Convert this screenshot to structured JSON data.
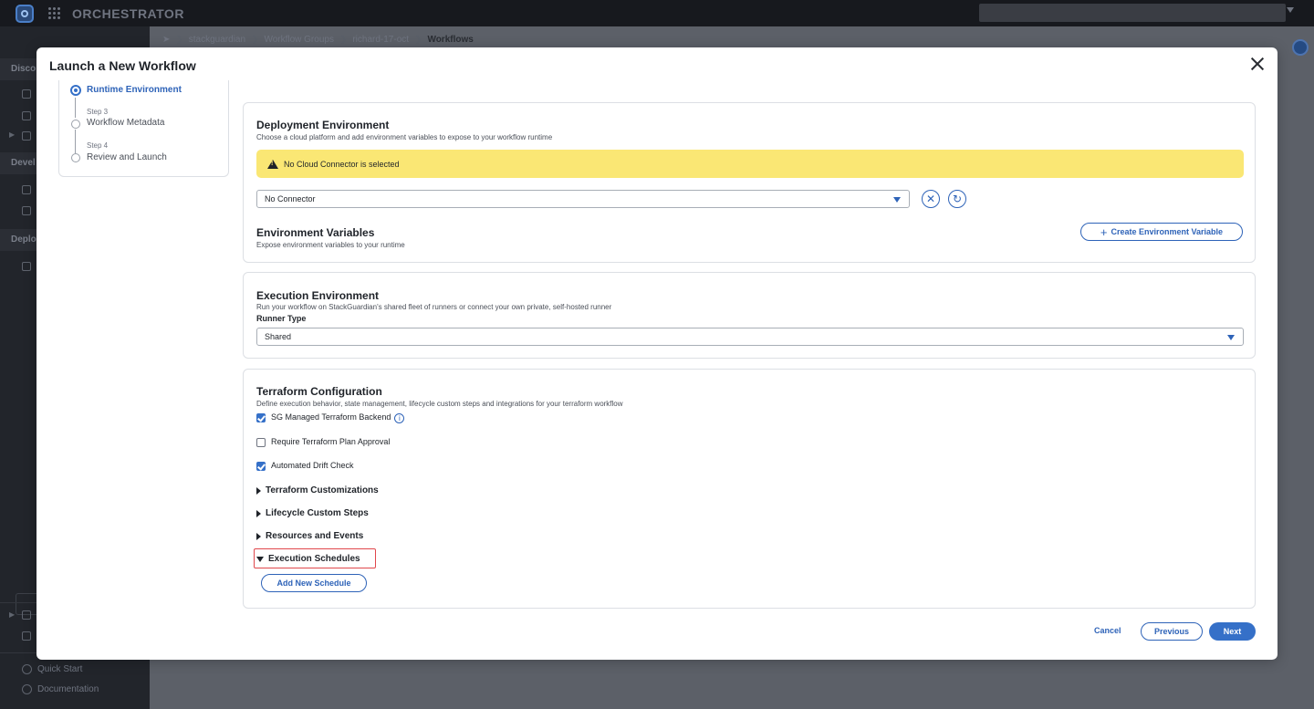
{
  "app": {
    "title": "ORCHESTRATOR"
  },
  "sidebar": {
    "sections": [
      "Disco",
      "Devel",
      "Deplo"
    ],
    "links": [
      "Quick Start",
      "Documentation"
    ]
  },
  "breadcrumb": [
    "stackguardian",
    "Workflow Groups",
    "richard-17-oct",
    "Workflows"
  ],
  "modal": {
    "title": "Launch a New Workflow",
    "stepper": {
      "steps": [
        {
          "number": "",
          "label": "Runtime Environment",
          "active": true
        },
        {
          "number": "Step 3",
          "label": "Workflow Metadata"
        },
        {
          "number": "Step 4",
          "label": "Review and Launch"
        }
      ]
    },
    "deployment": {
      "title": "Deployment Environment",
      "subtitle": "Choose a cloud platform and add environment variables to expose to your workflow runtime",
      "warning": "No Cloud Connector is selected",
      "connector_value": "No Connector",
      "env_title": "Environment Variables",
      "env_subtitle": "Expose environment variables to your runtime",
      "create_env_label": "Create Environment Variable"
    },
    "execution": {
      "title": "Execution Environment",
      "subtitle": "Run your workflow on StackGuardian's shared fleet of runners or connect your own private, self-hosted runner",
      "runner_type_label": "Runner Type",
      "runner_type_value": "Shared"
    },
    "terraform": {
      "title": "Terraform Configuration",
      "subtitle": "Define execution behavior, state management, lifecycle custom steps and integrations for your terraform workflow",
      "checkboxes": [
        {
          "label": "SG Managed Terraform Backend",
          "checked": true
        },
        {
          "label": "Require Terraform Plan Approval",
          "checked": false
        },
        {
          "label": "Automated Drift Check",
          "checked": true
        }
      ],
      "expanders": [
        {
          "label": "Terraform Customizations",
          "expanded": false
        },
        {
          "label": "Lifecycle Custom Steps",
          "expanded": false
        },
        {
          "label": "Resources and Events",
          "expanded": false
        },
        {
          "label": "Execution Schedules",
          "expanded": true
        }
      ],
      "add_schedule_label": "Add New Schedule"
    },
    "footer": {
      "cancel": "Cancel",
      "previous": "Previous",
      "next": "Next"
    }
  },
  "colors": {
    "accent": "#3570c8",
    "warning_bg": "#fae774",
    "highlight": "#e0474c"
  }
}
